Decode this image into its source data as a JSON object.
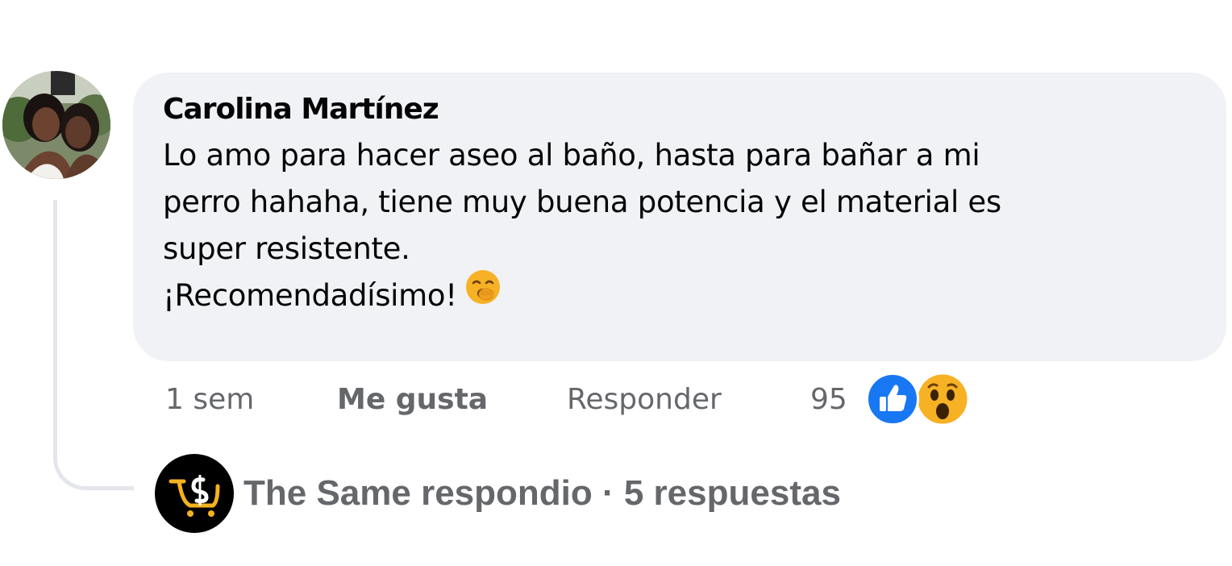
{
  "comment": {
    "author": "Carolina Martínez",
    "text_lines": [
      "Lo amo para hacer aseo al baño, hasta para bañar a mi",
      "perro hahaha, tiene muy buena potencia y el material es",
      "super resistente.",
      "¡Recomendadísimo!"
    ],
    "emoji": "yawning-face-emoji",
    "avatar": "user-avatar-photo"
  },
  "actions": {
    "time": "1 sem",
    "like_label": "Me gusta",
    "reply_label": "Responder",
    "reaction_count": "95",
    "reactions": [
      "like-reaction-icon",
      "wow-reaction-icon"
    ]
  },
  "reply_summary": {
    "page_logo": "the-same-logo",
    "text": "The Same respondio · 5 respuestas"
  },
  "colors": {
    "bubble_bg": "#f0f2f5",
    "meta_text": "#65676b",
    "like_blue": "#1877f2",
    "wow_yellow": "#f7b125"
  }
}
